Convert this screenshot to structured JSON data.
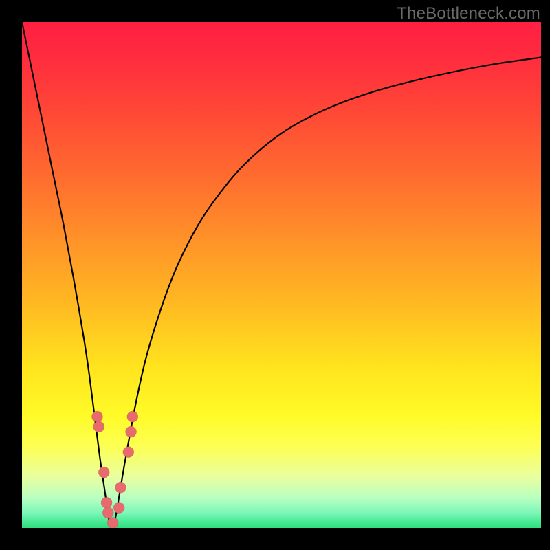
{
  "attribution": "TheBottleneck.com",
  "colors": {
    "marker": "#e96a6c",
    "curve": "#000000",
    "frame": "#000000"
  },
  "chart_data": {
    "type": "line",
    "title": "",
    "xlabel": "",
    "ylabel": "",
    "xlim": [
      0,
      100
    ],
    "ylim": [
      0,
      100
    ],
    "grid": false,
    "legend": false,
    "annotations": [],
    "series": [
      {
        "name": "bottleneck-curve",
        "x": [
          0,
          2,
          4,
          6,
          8,
          10,
          12,
          13,
          14,
          15,
          16,
          16.7,
          17.3,
          18,
          19,
          20,
          22,
          24,
          27,
          30,
          34,
          38,
          43,
          50,
          58,
          67,
          78,
          90,
          100
        ],
        "y": [
          100,
          90,
          80,
          70,
          60,
          49,
          37,
          30,
          22,
          14,
          7,
          2,
          0,
          2,
          8,
          14,
          25,
          34,
          44,
          52,
          60,
          66,
          72,
          78,
          82.5,
          86,
          89,
          91.5,
          93
        ]
      }
    ],
    "markers": [
      {
        "x": 14.5,
        "y": 22
      },
      {
        "x": 14.8,
        "y": 20
      },
      {
        "x": 15.8,
        "y": 11
      },
      {
        "x": 16.3,
        "y": 5
      },
      {
        "x": 16.6,
        "y": 3
      },
      {
        "x": 17.5,
        "y": 1
      },
      {
        "x": 18.7,
        "y": 4
      },
      {
        "x": 19.0,
        "y": 8
      },
      {
        "x": 20.5,
        "y": 15
      },
      {
        "x": 21.0,
        "y": 19
      },
      {
        "x": 21.3,
        "y": 22
      }
    ],
    "marker_radius_px": 8
  }
}
